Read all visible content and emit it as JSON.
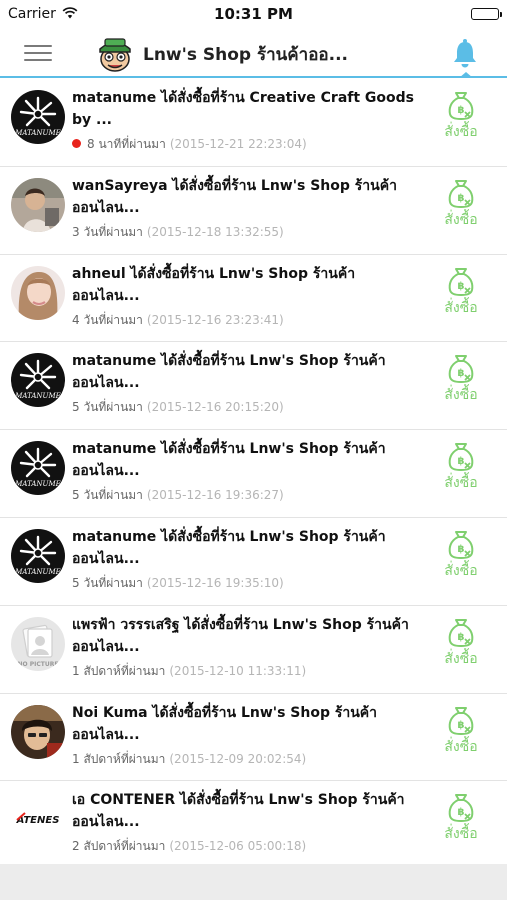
{
  "status_bar": {
    "carrier": "Carrier",
    "time": "10:31 PM"
  },
  "header": {
    "title": "Lnw's Shop ร้านค้าออ..."
  },
  "colors": {
    "accent": "#5bbde6",
    "action_green": "#7fcf6e",
    "new_dot": "#e8231c"
  },
  "notifications": [
    {
      "avatar": "matanume-logo",
      "message": "matanume ได้สั่งซื้อที่ร้าน Creative Craft Goods by ...",
      "relative_time": "8 นาทีที่ผ่านมา",
      "timestamp": "(2015-12-21 22:23:04)",
      "is_new": true,
      "action_label": "สั่งซื้อ"
    },
    {
      "avatar": "wansayreya-photo",
      "message": "wanSayreya ได้สั่งซื้อที่ร้าน Lnw's Shop ร้านค้าออนไลน...",
      "relative_time": "3 วันที่ผ่านมา",
      "timestamp": "(2015-12-18 13:32:55)",
      "is_new": false,
      "action_label": "สั่งซื้อ"
    },
    {
      "avatar": "ahneul-photo",
      "message": "ahneul ได้สั่งซื้อที่ร้าน Lnw's Shop ร้านค้าออนไลน...",
      "relative_time": "4 วันที่ผ่านมา",
      "timestamp": "(2015-12-16 23:23:41)",
      "is_new": false,
      "action_label": "สั่งซื้อ"
    },
    {
      "avatar": "matanume-logo",
      "message": "matanume ได้สั่งซื้อที่ร้าน Lnw's Shop ร้านค้าออนไลน...",
      "relative_time": "5 วันที่ผ่านมา",
      "timestamp": "(2015-12-16 20:15:20)",
      "is_new": false,
      "action_label": "สั่งซื้อ"
    },
    {
      "avatar": "matanume-logo",
      "message": "matanume ได้สั่งซื้อที่ร้าน Lnw's Shop ร้านค้าออนไลน...",
      "relative_time": "5 วันที่ผ่านมา",
      "timestamp": "(2015-12-16 19:36:27)",
      "is_new": false,
      "action_label": "สั่งซื้อ"
    },
    {
      "avatar": "matanume-logo",
      "message": "matanume ได้สั่งซื้อที่ร้าน Lnw's Shop ร้านค้าออนไลน...",
      "relative_time": "5 วันที่ผ่านมา",
      "timestamp": "(2015-12-16 19:35:10)",
      "is_new": false,
      "action_label": "สั่งซื้อ"
    },
    {
      "avatar": "no-picture",
      "avatar_text": "NO PICTURE",
      "message": "แพรฟ้า วรรรเสริฐ ได้สั่งซื้อที่ร้าน Lnw's Shop ร้านค้าออนไลน...",
      "relative_time": "1 สัปดาห์ที่ผ่านมา",
      "timestamp": "(2015-12-10 11:33:11)",
      "is_new": false,
      "action_label": "สั่งซื้อ"
    },
    {
      "avatar": "noi-kuma-photo",
      "message": "Noi Kuma ได้สั่งซื้อที่ร้าน Lnw's Shop ร้านค้าออนไลน...",
      "relative_time": "1 สัปดาห์ที่ผ่านมา",
      "timestamp": "(2015-12-09 20:02:54)",
      "is_new": false,
      "action_label": "สั่งซื้อ"
    },
    {
      "avatar": "atenes-logo",
      "avatar_text": "ATENES",
      "message": "เอ CONTENER ได้สั่งซื้อที่ร้าน Lnw's Shop ร้านค้าออนไลน...",
      "relative_time": "2 สัปดาห์ที่ผ่านมา",
      "timestamp": "(2015-12-06 05:00:18)",
      "is_new": false,
      "action_label": "สั่งซื้อ"
    }
  ]
}
